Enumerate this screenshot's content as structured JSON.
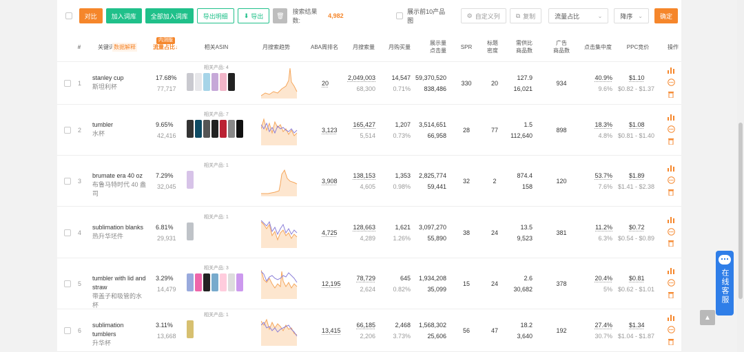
{
  "toolbar": {
    "compare": "对比",
    "add_to_lib": "加入词库",
    "add_all_to_lib": "全部加入词库",
    "export_detail": "导出明细",
    "export": "导出",
    "result_label": "搜索结果数:",
    "result_count": "4,982",
    "show_top10": "展示前10产品图",
    "custom_cols": "自定义列",
    "copy": "复制",
    "sort_field": "流量占比",
    "sort_order": "降序",
    "confirm": "确定"
  },
  "header": {
    "idx": "#",
    "keyword": "关键词",
    "data_explain": "数据解释",
    "traffic_share": "流量占比↓",
    "internal_badge": "内测版",
    "related_asin": "相关ASIN",
    "monthly_trend": "月搜索趋势",
    "aba_rank": "ABA周排名",
    "monthly_search": "月搜索量",
    "monthly_buy": "月购买量",
    "impressions_line1": "展示量",
    "impressions_line2": "点击量",
    "spr": "SPR",
    "title_line1": "标题",
    "title_line2": "密度",
    "supply_line1": "需供比",
    "supply_line2": "商品数",
    "ads_line1": "广告",
    "ads_line2": "商品数",
    "click_conc": "点击集中度",
    "ppc": "PPC竞价",
    "ops": "操作"
  },
  "rows": [
    {
      "idx": "1",
      "kw": "stanley cup",
      "kw_cn": "斯坦利杯",
      "share": "17.68%",
      "share_sub": "77,717",
      "related": "相关产品: 4",
      "aba": "20",
      "search": "2,049,003",
      "search_sub": "68,300",
      "buy": "14,547",
      "buy_sub": "0.71%",
      "imp": "59,370,520",
      "clicks": "838,486",
      "spr": "330",
      "title": "20",
      "supply": "127.9",
      "goods": "16,021",
      "ads": "934",
      "conc": "40.9%",
      "conc_sub": "9.6%",
      "ppc": "$1.10",
      "ppc_range": "$0.82 - $1.37"
    },
    {
      "idx": "2",
      "kw": "tumbler",
      "kw_cn": "水杯",
      "share": "9.65%",
      "share_sub": "42,416",
      "related": "相关产品: 7",
      "aba": "3,123",
      "search": "165,427",
      "search_sub": "5,514",
      "buy": "1,207",
      "buy_sub": "0.73%",
      "imp": "3,514,651",
      "clicks": "66,958",
      "spr": "28",
      "title": "77",
      "supply": "1.5",
      "goods": "112,640",
      "ads": "898",
      "conc": "18.3%",
      "conc_sub": "4.8%",
      "ppc": "$1.08",
      "ppc_range": "$0.81 - $1.40"
    },
    {
      "idx": "3",
      "kw": "brumate era 40 oz",
      "kw_cn": "布鲁马特时代 40 盎司",
      "share": "7.29%",
      "share_sub": "32,045",
      "related": "相关产品: 1",
      "aba": "3,908",
      "search": "138,153",
      "search_sub": "4,605",
      "buy": "1,353",
      "buy_sub": "0.98%",
      "imp": "2,825,774",
      "clicks": "59,441",
      "spr": "32",
      "title": "2",
      "supply": "874.4",
      "goods": "158",
      "ads": "120",
      "conc": "53.7%",
      "conc_sub": "7.6%",
      "ppc": "$1.89",
      "ppc_range": "$1.41 - $2.38"
    },
    {
      "idx": "4",
      "kw": "sublimation blanks",
      "kw_cn": "热升华坯件",
      "share": "6.81%",
      "share_sub": "29,931",
      "related": "相关产品: 1",
      "aba": "4,725",
      "search": "128,663",
      "search_sub": "4,289",
      "buy": "1,621",
      "buy_sub": "1.26%",
      "imp": "3,097,270",
      "clicks": "55,890",
      "spr": "38",
      "title": "24",
      "supply": "13.5",
      "goods": "9,523",
      "ads": "381",
      "conc": "11.2%",
      "conc_sub": "6.3%",
      "ppc": "$0.72",
      "ppc_range": "$0.54 - $0.89"
    },
    {
      "idx": "5",
      "kw": "tumbler with lid and straw",
      "kw_cn": "带盖子和吸管的水杯",
      "share": "3.29%",
      "share_sub": "14,479",
      "related": "相关产品: 3",
      "aba": "12,195",
      "search": "78,729",
      "search_sub": "2,624",
      "buy": "645",
      "buy_sub": "0.82%",
      "imp": "1,934,208",
      "clicks": "35,099",
      "spr": "15",
      "title": "24",
      "supply": "2.6",
      "goods": "30,682",
      "ads": "378",
      "conc": "20.4%",
      "conc_sub": "5%",
      "ppc": "$0.81",
      "ppc_range": "$0.62 - $1.01"
    },
    {
      "idx": "6",
      "kw": "sublimation tumblers",
      "kw_cn": "升华杯",
      "share": "3.11%",
      "share_sub": "13,668",
      "related": "相关产品: 1",
      "aba": "13,415",
      "search": "66,185",
      "search_sub": "2,206",
      "buy": "2,468",
      "buy_sub": "3.73%",
      "imp": "1,568,302",
      "clicks": "25,606",
      "spr": "56",
      "title": "47",
      "supply": "18.2",
      "goods": "3,640",
      "ads": "192",
      "conc": "27.4%",
      "conc_sub": "30.7%",
      "ppc": "$1.34",
      "ppc_range": "$1.04 - $1.87"
    }
  ],
  "chat": {
    "label": "在线客服"
  },
  "colors": {
    "accent": "#f5862b",
    "green": "#20c08a",
    "chat": "#2f7ee8",
    "trend_orange": "#f5a65b",
    "trend_purple": "#8b7fd8"
  }
}
